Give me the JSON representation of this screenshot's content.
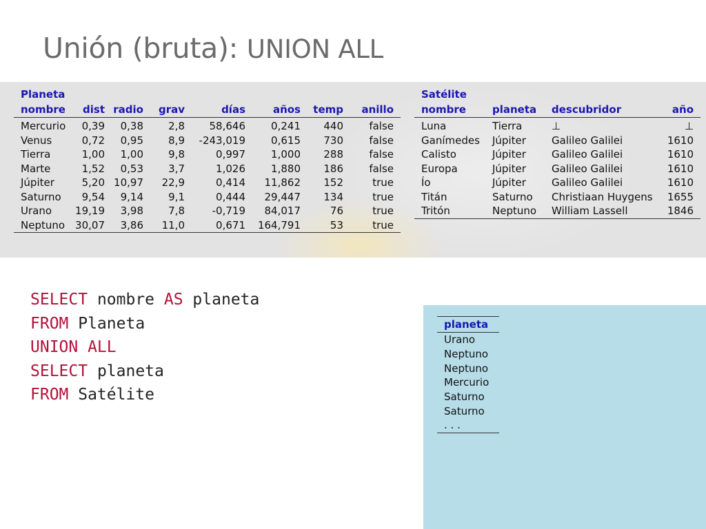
{
  "slide": {
    "title_main": "Unión (bruta): ",
    "title_code": "UNION ALL"
  },
  "planeta": {
    "name": "Planeta",
    "columns": [
      "nombre",
      "dist",
      "radio",
      "grav",
      "días",
      "años",
      "temp",
      "anillo"
    ],
    "rows": [
      [
        "Mercurio",
        "0,39",
        "0,38",
        "2,8",
        "58,646",
        "0,241",
        "440",
        "false"
      ],
      [
        "Venus",
        "0,72",
        "0,95",
        "8,9",
        "-243,019",
        "0,615",
        "730",
        "false"
      ],
      [
        "Tierra",
        "1,00",
        "1,00",
        "9,8",
        "0,997",
        "1,000",
        "288",
        "false"
      ],
      [
        "Marte",
        "1,52",
        "0,53",
        "3,7",
        "1,026",
        "1,880",
        "186",
        "false"
      ],
      [
        "Júpiter",
        "5,20",
        "10,97",
        "22,9",
        "0,414",
        "11,862",
        "152",
        "true"
      ],
      [
        "Saturno",
        "9,54",
        "9,14",
        "9,1",
        "0,444",
        "29,447",
        "134",
        "true"
      ],
      [
        "Urano",
        "19,19",
        "3,98",
        "7,8",
        "-0,719",
        "84,017",
        "76",
        "true"
      ],
      [
        "Neptuno",
        "30,07",
        "3,86",
        "11,0",
        "0,671",
        "164,791",
        "53",
        "true"
      ]
    ]
  },
  "satelite": {
    "name": "Satélite",
    "columns": [
      "nombre",
      "planeta",
      "descubridor",
      "año"
    ],
    "rows": [
      [
        "Luna",
        "Tierra",
        "⊥",
        "⊥"
      ],
      [
        "Ganímedes",
        "Júpiter",
        "Galileo Galilei",
        "1610"
      ],
      [
        "Calisto",
        "Júpiter",
        "Galileo Galilei",
        "1610"
      ],
      [
        "Europa",
        "Júpiter",
        "Galileo Galilei",
        "1610"
      ],
      [
        "Ío",
        "Júpiter",
        "Galileo Galilei",
        "1610"
      ],
      [
        "Titán",
        "Saturno",
        "Christiaan Huygens",
        "1655"
      ],
      [
        "Tritón",
        "Neptuno",
        "William Lassell",
        "1846"
      ]
    ]
  },
  "query": {
    "l1_kw1": "SELECT",
    "l1_t1": " nombre ",
    "l1_kw2": "AS",
    "l1_t2": " planeta",
    "l2_kw": "FROM",
    "l2_t": " Planeta",
    "l3_kw": "UNION ALL",
    "l4_kw": "SELECT",
    "l4_t": " planeta",
    "l5_kw": "FROM",
    "l5_t": " Satélite"
  },
  "result": {
    "column": "planeta",
    "rows": [
      "Urano",
      "Neptuno",
      "Neptuno",
      "Mercurio",
      "Saturno",
      "Saturno",
      ". . ."
    ]
  }
}
